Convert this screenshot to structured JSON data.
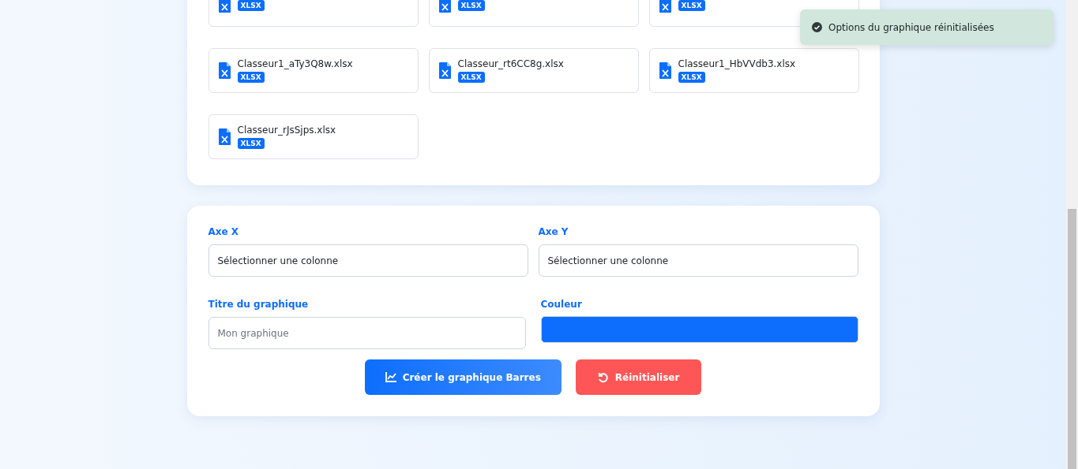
{
  "files": [
    {
      "badge": "XLSX"
    },
    {
      "badge": "XLSX"
    },
    {
      "badge": "XLSX"
    },
    {
      "name": "Classeur1_aTy3Q8w.xlsx",
      "badge": "XLSX"
    },
    {
      "name": "Classeur_rt6CC8g.xlsx",
      "badge": "XLSX"
    },
    {
      "name": "Classeur1_HbVVdb3.xlsx",
      "badge": "XLSX"
    },
    {
      "name": "Classeur_rJsSjps.xlsx",
      "badge": "XLSX"
    }
  ],
  "form": {
    "x_axis": {
      "label": "Axe X",
      "value": "Sélectionner une colonne"
    },
    "y_axis": {
      "label": "Axe Y",
      "value": "Sélectionner une colonne"
    },
    "title": {
      "label": "Titre du graphique",
      "placeholder": "Mon graphique"
    },
    "color": {
      "label": "Couleur",
      "color": "#0d6efd"
    }
  },
  "buttons": [
    {
      "kind": "create",
      "label": "Créer le graphique Barres"
    },
    {
      "kind": "reset",
      "label": "Réinitialiser"
    }
  ],
  "toast": {
    "message": "Options du graphique réinitialisées"
  }
}
